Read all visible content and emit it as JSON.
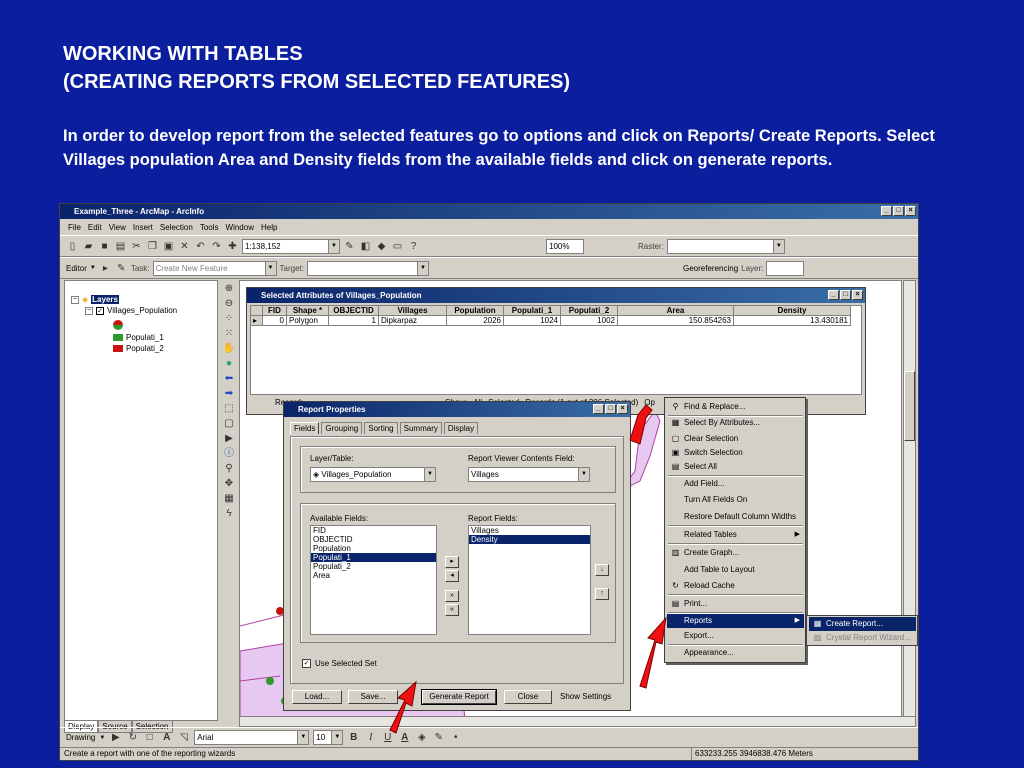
{
  "slide": {
    "title_line1": "WORKING WITH TABLES",
    "title_line2": "(CREATING REPORTS FROM SELECTED FEATURES)",
    "body": "In order to develop report from the selected features go to options and click on Reports/ Create Reports. Select Villages population Area and Density fields from the available fields and click on generate reports."
  },
  "app": {
    "title": "Example_Three - ArcMap - ArcInfo",
    "menus": [
      "File",
      "Edit",
      "View",
      "Insert",
      "Selection",
      "Tools",
      "Window",
      "Help"
    ],
    "scale": "1:138,152",
    "zoom": "100%",
    "raster_label": "Raster:",
    "editor_label": "Editor",
    "task_label": "Task:",
    "task_value": "Create New Feature",
    "target_label": "Target:",
    "georef_label": "Georeferencing",
    "layer_label": "Layer:",
    "toc": {
      "root": "Layers",
      "layer": "Villages_Population",
      "legend": [
        "Populati_1",
        "Populati_2"
      ],
      "tabs": [
        "Display",
        "Source",
        "Selection"
      ]
    },
    "drawing_label": "Drawing",
    "font_name": "Arial",
    "font_size": "10",
    "status_text": "Create a report with one of the reporting wizards",
    "coordinates": "633233.255  3946838.476 Meters",
    "colors": {
      "legend_green": "#2e9a2e",
      "legend_red": "#cc1111",
      "map_fill": "#e6c8f0"
    }
  },
  "attr_window": {
    "title": "Selected Attributes of Villages_Population",
    "columns": [
      "FID",
      "Shape *",
      "OBJECTID",
      "Villages",
      "Population",
      "Populati_1",
      "Populati_2",
      "Area",
      "Density"
    ],
    "row": [
      "0",
      "Polygon",
      "1",
      "Dipkarpaz",
      "2026",
      "1024",
      "1002",
      "150.854263",
      "13.430181"
    ],
    "footer_record": "Record:",
    "footer_show": "Show:",
    "footer_all": "All",
    "footer_selected": "Selected",
    "footer_records": "Records (1 out of 306 Selected)",
    "footer_options": "Op"
  },
  "report_dialog": {
    "title": "Report Properties",
    "tabs": [
      "Fields",
      "Grouping",
      "Sorting",
      "Summary",
      "Display"
    ],
    "layer_table_label": "Layer/Table:",
    "layer_table_value": "Villages_Population",
    "viewer_field_label": "Report Viewer Contents Field:",
    "viewer_field_value": "Villages",
    "available_label": "Available Fields:",
    "available_fields": [
      "FID",
      "OBJECTID",
      "Population",
      "Populati_1",
      "Populati_2",
      "Area"
    ],
    "report_label": "Report Fields:",
    "report_fields": [
      "Villages",
      "Density"
    ],
    "use_selected": "Use Selected Set",
    "load": "Load...",
    "save": "Save...",
    "generate": "Generate Report",
    "close": "Close",
    "show_settings": "Show Settings"
  },
  "context_menu": {
    "items": [
      "Find & Replace...",
      "Select By Attributes...",
      "Clear Selection",
      "Switch Selection",
      "Select All",
      "Add Field...",
      "Turn All Fields On",
      "Restore Default Column Widths",
      "Related Tables",
      "Create Graph...",
      "Add Table to Layout",
      "Reload Cache",
      "Print...",
      "Reports",
      "Export...",
      "Appearance..."
    ],
    "submenu": [
      "Create Report...",
      "Crystal Report Wizard..."
    ]
  }
}
